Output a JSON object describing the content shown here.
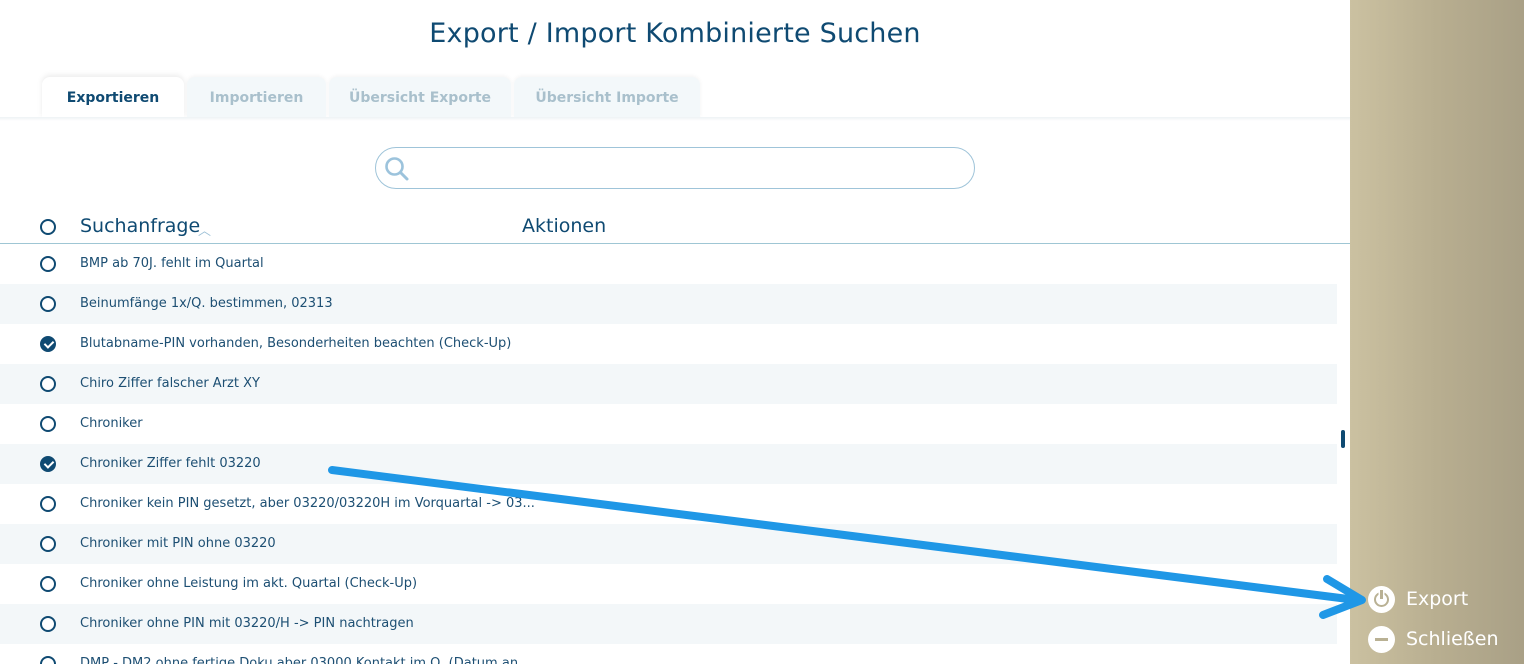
{
  "page": {
    "title": "Export / Import Kombinierte Suchen"
  },
  "tabs": [
    {
      "label": "Exportieren",
      "active": true
    },
    {
      "label": "Importieren",
      "active": false
    },
    {
      "label": "Übersicht Exporte",
      "active": false
    },
    {
      "label": "Übersicht Importe",
      "active": false
    }
  ],
  "search": {
    "value": "",
    "placeholder": "",
    "icon": "search-icon"
  },
  "table": {
    "columns": {
      "query": "Suchanfrage",
      "actions": "Aktionen"
    },
    "sort_indicator": "︿",
    "rows": [
      {
        "label": "BMP ab 70J. fehlt im Quartal",
        "checked": false
      },
      {
        "label": "Beinumfänge 1x/Q. bestimmen, 02313",
        "checked": false
      },
      {
        "label": "Blutabname-PIN vorhanden, Besonderheiten beachten (Check-Up)",
        "checked": true
      },
      {
        "label": "Chiro Ziffer falscher Arzt XY",
        "checked": false
      },
      {
        "label": "Chroniker",
        "checked": false
      },
      {
        "label": "Chroniker Ziffer fehlt 03220",
        "checked": true
      },
      {
        "label": "Chroniker kein PIN gesetzt, aber 03220/03220H im Vorquartal -> 03...",
        "checked": false
      },
      {
        "label": "Chroniker mit PIN ohne 03220",
        "checked": false
      },
      {
        "label": "Chroniker ohne Leistung im akt. Quartal (Check-Up)",
        "checked": false
      },
      {
        "label": "Chroniker ohne PIN mit 03220/H  -> PIN nachtragen",
        "checked": false
      },
      {
        "label": "DMP - DM2 ohne fertige Doku aber 03000 Kontakt im Q. (Datum an...",
        "checked": false
      }
    ]
  },
  "sidebar": {
    "export_label": "Export",
    "export_icon": "power-icon",
    "close_label": "Schließen",
    "close_icon": "minus-circle-icon"
  },
  "colors": {
    "primary": "#0f4a72",
    "sidebar": "#b8ae90",
    "annotation_arrow": "#1f97e6",
    "row_alt": "#f3f7f9"
  }
}
